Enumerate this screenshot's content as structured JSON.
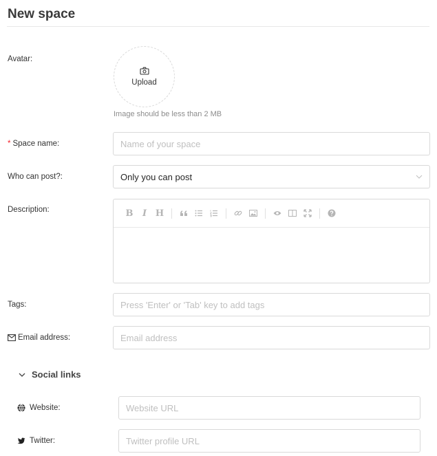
{
  "page": {
    "title": "New space"
  },
  "avatar": {
    "label": "Avatar:",
    "upload_label": "Upload",
    "hint": "Image should be less than 2 MB"
  },
  "space_name": {
    "required_mark": "*",
    "label": "Space name:",
    "placeholder": "Name of your space"
  },
  "who_can_post": {
    "label": "Who can post?:",
    "value": "Only you can post"
  },
  "description": {
    "label": "Description:",
    "toolbar": [
      "bold-icon",
      "italic-icon",
      "heading-icon",
      "quote-icon",
      "unordered-list-icon",
      "ordered-list-icon",
      "link-icon",
      "image-icon",
      "preview-icon",
      "side-by-side-icon",
      "fullscreen-icon",
      "help-icon"
    ],
    "bold_glyph": "B",
    "italic_glyph": "I",
    "heading_glyph": "H"
  },
  "tags": {
    "label": "Tags:",
    "placeholder": "Press 'Enter' or 'Tab' key to add tags"
  },
  "email": {
    "label": "Email address:",
    "placeholder": "Email address"
  },
  "social_links": {
    "toggle_label": "Social links",
    "website": {
      "label": "Website:",
      "placeholder": "Website URL"
    },
    "twitter": {
      "label": "Twitter:",
      "placeholder": "Twitter profile URL"
    }
  },
  "colors": {
    "required": "#f5222d",
    "border": "#d9d9d9",
    "placeholder": "#bfbfbf"
  }
}
